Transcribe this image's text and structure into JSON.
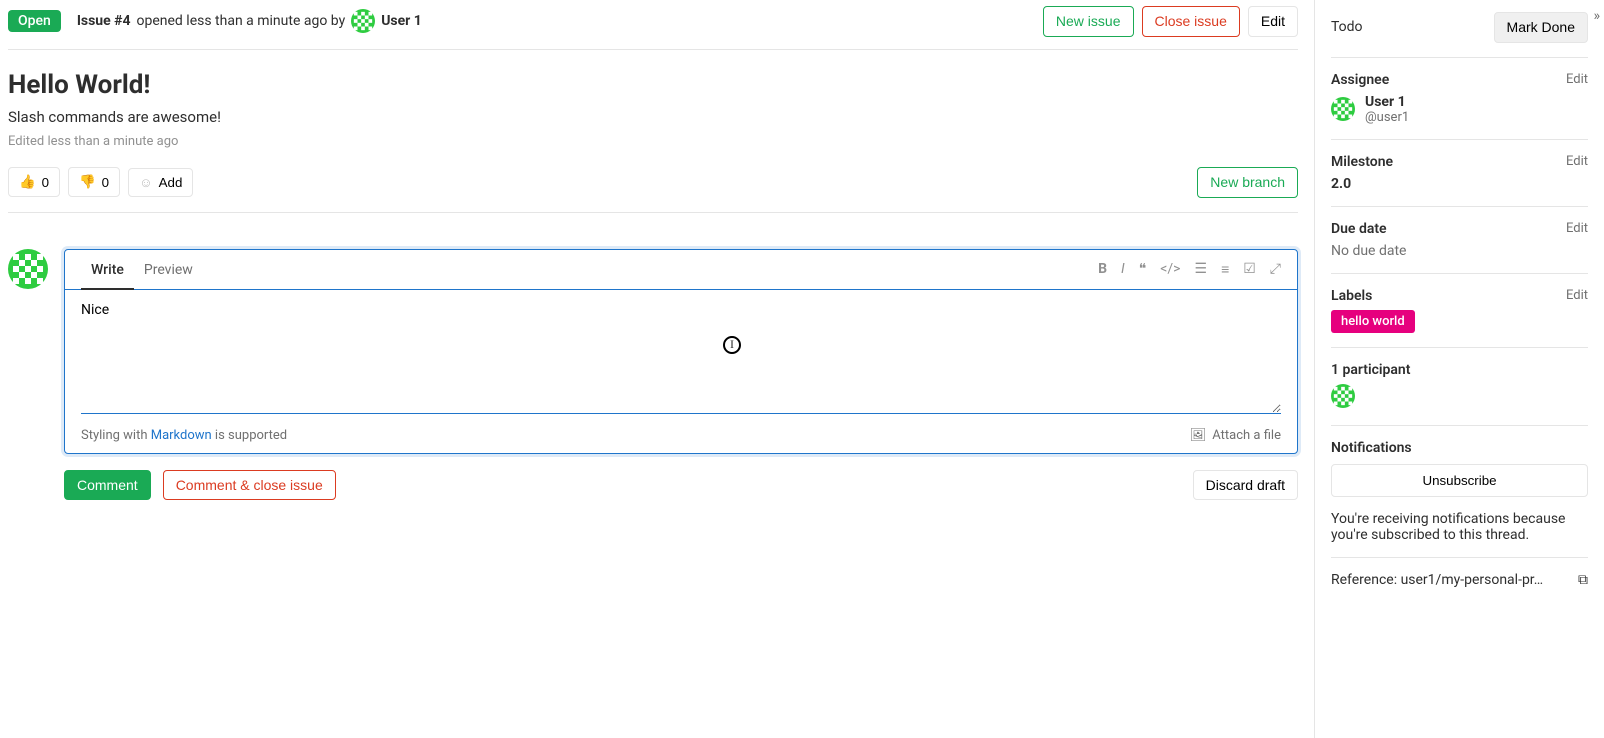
{
  "header": {
    "status": "Open",
    "issue_id": "Issue #4",
    "opened_text": "opened less than a minute ago by",
    "author": "User 1",
    "actions": {
      "new_issue": "New issue",
      "close_issue": "Close issue",
      "edit": "Edit"
    }
  },
  "issue": {
    "title": "Hello World!",
    "description": "Slash commands are awesome!",
    "edited": "Edited less than a minute ago"
  },
  "reactions": {
    "thumbs_up": "0",
    "thumbs_down": "0",
    "add": "Add",
    "new_branch": "New branch"
  },
  "editor": {
    "tab_write": "Write",
    "tab_preview": "Preview",
    "comment_value": "Nice",
    "footer_prefix": "Styling with ",
    "footer_link": "Markdown",
    "footer_suffix": " is supported",
    "attach": "Attach a file"
  },
  "comment_actions": {
    "comment": "Comment",
    "comment_close": "Comment & close issue",
    "discard": "Discard draft"
  },
  "sidebar": {
    "todo": {
      "label": "Todo",
      "mark_done": "Mark Done"
    },
    "assignee": {
      "label": "Assignee",
      "edit": "Edit",
      "name": "User 1",
      "handle": "@user1"
    },
    "milestone": {
      "label": "Milestone",
      "edit": "Edit",
      "value": "2.0"
    },
    "due_date": {
      "label": "Due date",
      "edit": "Edit",
      "value": "No due date"
    },
    "labels": {
      "label": "Labels",
      "edit": "Edit",
      "chip": "hello world"
    },
    "participants": {
      "label": "1 participant"
    },
    "notifications": {
      "label": "Notifications",
      "unsubscribe": "Unsubscribe",
      "note": "You're receiving notifications because you're subscribed to this thread."
    },
    "reference": {
      "prefix": "Reference: ",
      "value": "user1/my-personal-pr…"
    }
  }
}
